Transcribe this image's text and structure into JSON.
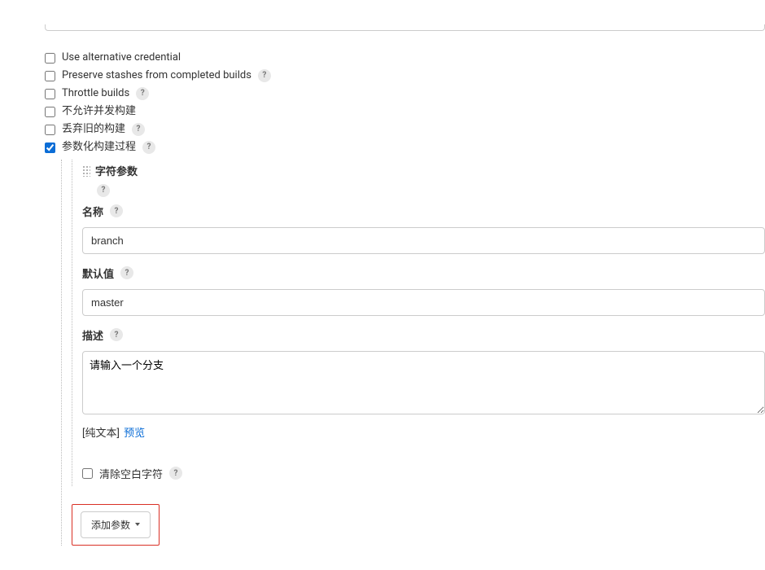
{
  "options": {
    "use_alt_cred": {
      "label": "Use alternative credential",
      "checked": false,
      "has_help": false
    },
    "preserve_stashes": {
      "label": "Preserve stashes from completed builds",
      "checked": false,
      "has_help": true
    },
    "throttle_builds": {
      "label": "Throttle builds",
      "checked": false,
      "has_help": true
    },
    "no_concurrent": {
      "label": "不允许并发构建",
      "checked": false,
      "has_help": false
    },
    "discard_old": {
      "label": "丢弃旧的构建",
      "checked": false,
      "has_help": true
    },
    "parametrized": {
      "label": "参数化构建过程",
      "checked": true,
      "has_help": true
    }
  },
  "param": {
    "type_label": "字符参数",
    "name_label": "名称",
    "name_value": "branch",
    "default_label": "默认值",
    "default_value": "master",
    "description_label": "描述",
    "description_value": "请输入一个分支",
    "plaintext_label": "[纯文本]",
    "preview_label": "预览",
    "trim_label": "清除空白字符",
    "trim_checked": false
  },
  "add_param_label": "添加参数",
  "help_glyph": "?"
}
